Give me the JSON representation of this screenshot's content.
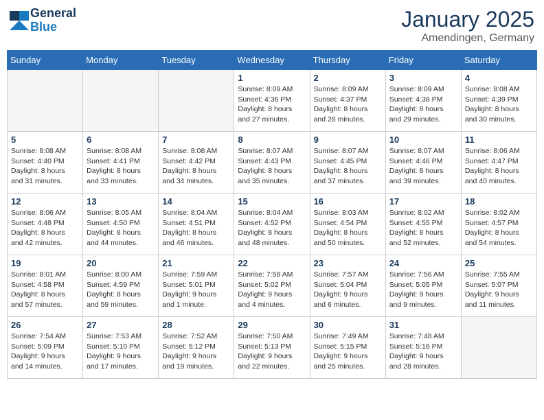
{
  "header": {
    "logo_general": "General",
    "logo_blue": "Blue",
    "month": "January 2025",
    "location": "Amendingen, Germany"
  },
  "weekdays": [
    "Sunday",
    "Monday",
    "Tuesday",
    "Wednesday",
    "Thursday",
    "Friday",
    "Saturday"
  ],
  "weeks": [
    [
      {
        "day": "",
        "info": ""
      },
      {
        "day": "",
        "info": ""
      },
      {
        "day": "",
        "info": ""
      },
      {
        "day": "1",
        "info": "Sunrise: 8:09 AM\nSunset: 4:36 PM\nDaylight: 8 hours and 27 minutes."
      },
      {
        "day": "2",
        "info": "Sunrise: 8:09 AM\nSunset: 4:37 PM\nDaylight: 8 hours and 28 minutes."
      },
      {
        "day": "3",
        "info": "Sunrise: 8:09 AM\nSunset: 4:38 PM\nDaylight: 8 hours and 29 minutes."
      },
      {
        "day": "4",
        "info": "Sunrise: 8:08 AM\nSunset: 4:39 PM\nDaylight: 8 hours and 30 minutes."
      }
    ],
    [
      {
        "day": "5",
        "info": "Sunrise: 8:08 AM\nSunset: 4:40 PM\nDaylight: 8 hours and 31 minutes."
      },
      {
        "day": "6",
        "info": "Sunrise: 8:08 AM\nSunset: 4:41 PM\nDaylight: 8 hours and 33 minutes."
      },
      {
        "day": "7",
        "info": "Sunrise: 8:08 AM\nSunset: 4:42 PM\nDaylight: 8 hours and 34 minutes."
      },
      {
        "day": "8",
        "info": "Sunrise: 8:07 AM\nSunset: 4:43 PM\nDaylight: 8 hours and 35 minutes."
      },
      {
        "day": "9",
        "info": "Sunrise: 8:07 AM\nSunset: 4:45 PM\nDaylight: 8 hours and 37 minutes."
      },
      {
        "day": "10",
        "info": "Sunrise: 8:07 AM\nSunset: 4:46 PM\nDaylight: 8 hours and 39 minutes."
      },
      {
        "day": "11",
        "info": "Sunrise: 8:06 AM\nSunset: 4:47 PM\nDaylight: 8 hours and 40 minutes."
      }
    ],
    [
      {
        "day": "12",
        "info": "Sunrise: 8:06 AM\nSunset: 4:48 PM\nDaylight: 8 hours and 42 minutes."
      },
      {
        "day": "13",
        "info": "Sunrise: 8:05 AM\nSunset: 4:50 PM\nDaylight: 8 hours and 44 minutes."
      },
      {
        "day": "14",
        "info": "Sunrise: 8:04 AM\nSunset: 4:51 PM\nDaylight: 8 hours and 46 minutes."
      },
      {
        "day": "15",
        "info": "Sunrise: 8:04 AM\nSunset: 4:52 PM\nDaylight: 8 hours and 48 minutes."
      },
      {
        "day": "16",
        "info": "Sunrise: 8:03 AM\nSunset: 4:54 PM\nDaylight: 8 hours and 50 minutes."
      },
      {
        "day": "17",
        "info": "Sunrise: 8:02 AM\nSunset: 4:55 PM\nDaylight: 8 hours and 52 minutes."
      },
      {
        "day": "18",
        "info": "Sunrise: 8:02 AM\nSunset: 4:57 PM\nDaylight: 8 hours and 54 minutes."
      }
    ],
    [
      {
        "day": "19",
        "info": "Sunrise: 8:01 AM\nSunset: 4:58 PM\nDaylight: 8 hours and 57 minutes."
      },
      {
        "day": "20",
        "info": "Sunrise: 8:00 AM\nSunset: 4:59 PM\nDaylight: 8 hours and 59 minutes."
      },
      {
        "day": "21",
        "info": "Sunrise: 7:59 AM\nSunset: 5:01 PM\nDaylight: 9 hours and 1 minute."
      },
      {
        "day": "22",
        "info": "Sunrise: 7:58 AM\nSunset: 5:02 PM\nDaylight: 9 hours and 4 minutes."
      },
      {
        "day": "23",
        "info": "Sunrise: 7:57 AM\nSunset: 5:04 PM\nDaylight: 9 hours and 6 minutes."
      },
      {
        "day": "24",
        "info": "Sunrise: 7:56 AM\nSunset: 5:05 PM\nDaylight: 9 hours and 9 minutes."
      },
      {
        "day": "25",
        "info": "Sunrise: 7:55 AM\nSunset: 5:07 PM\nDaylight: 9 hours and 11 minutes."
      }
    ],
    [
      {
        "day": "26",
        "info": "Sunrise: 7:54 AM\nSunset: 5:09 PM\nDaylight: 9 hours and 14 minutes."
      },
      {
        "day": "27",
        "info": "Sunrise: 7:53 AM\nSunset: 5:10 PM\nDaylight: 9 hours and 17 minutes."
      },
      {
        "day": "28",
        "info": "Sunrise: 7:52 AM\nSunset: 5:12 PM\nDaylight: 9 hours and 19 minutes."
      },
      {
        "day": "29",
        "info": "Sunrise: 7:50 AM\nSunset: 5:13 PM\nDaylight: 9 hours and 22 minutes."
      },
      {
        "day": "30",
        "info": "Sunrise: 7:49 AM\nSunset: 5:15 PM\nDaylight: 9 hours and 25 minutes."
      },
      {
        "day": "31",
        "info": "Sunrise: 7:48 AM\nSunset: 5:16 PM\nDaylight: 9 hours and 28 minutes."
      },
      {
        "day": "",
        "info": ""
      }
    ]
  ]
}
